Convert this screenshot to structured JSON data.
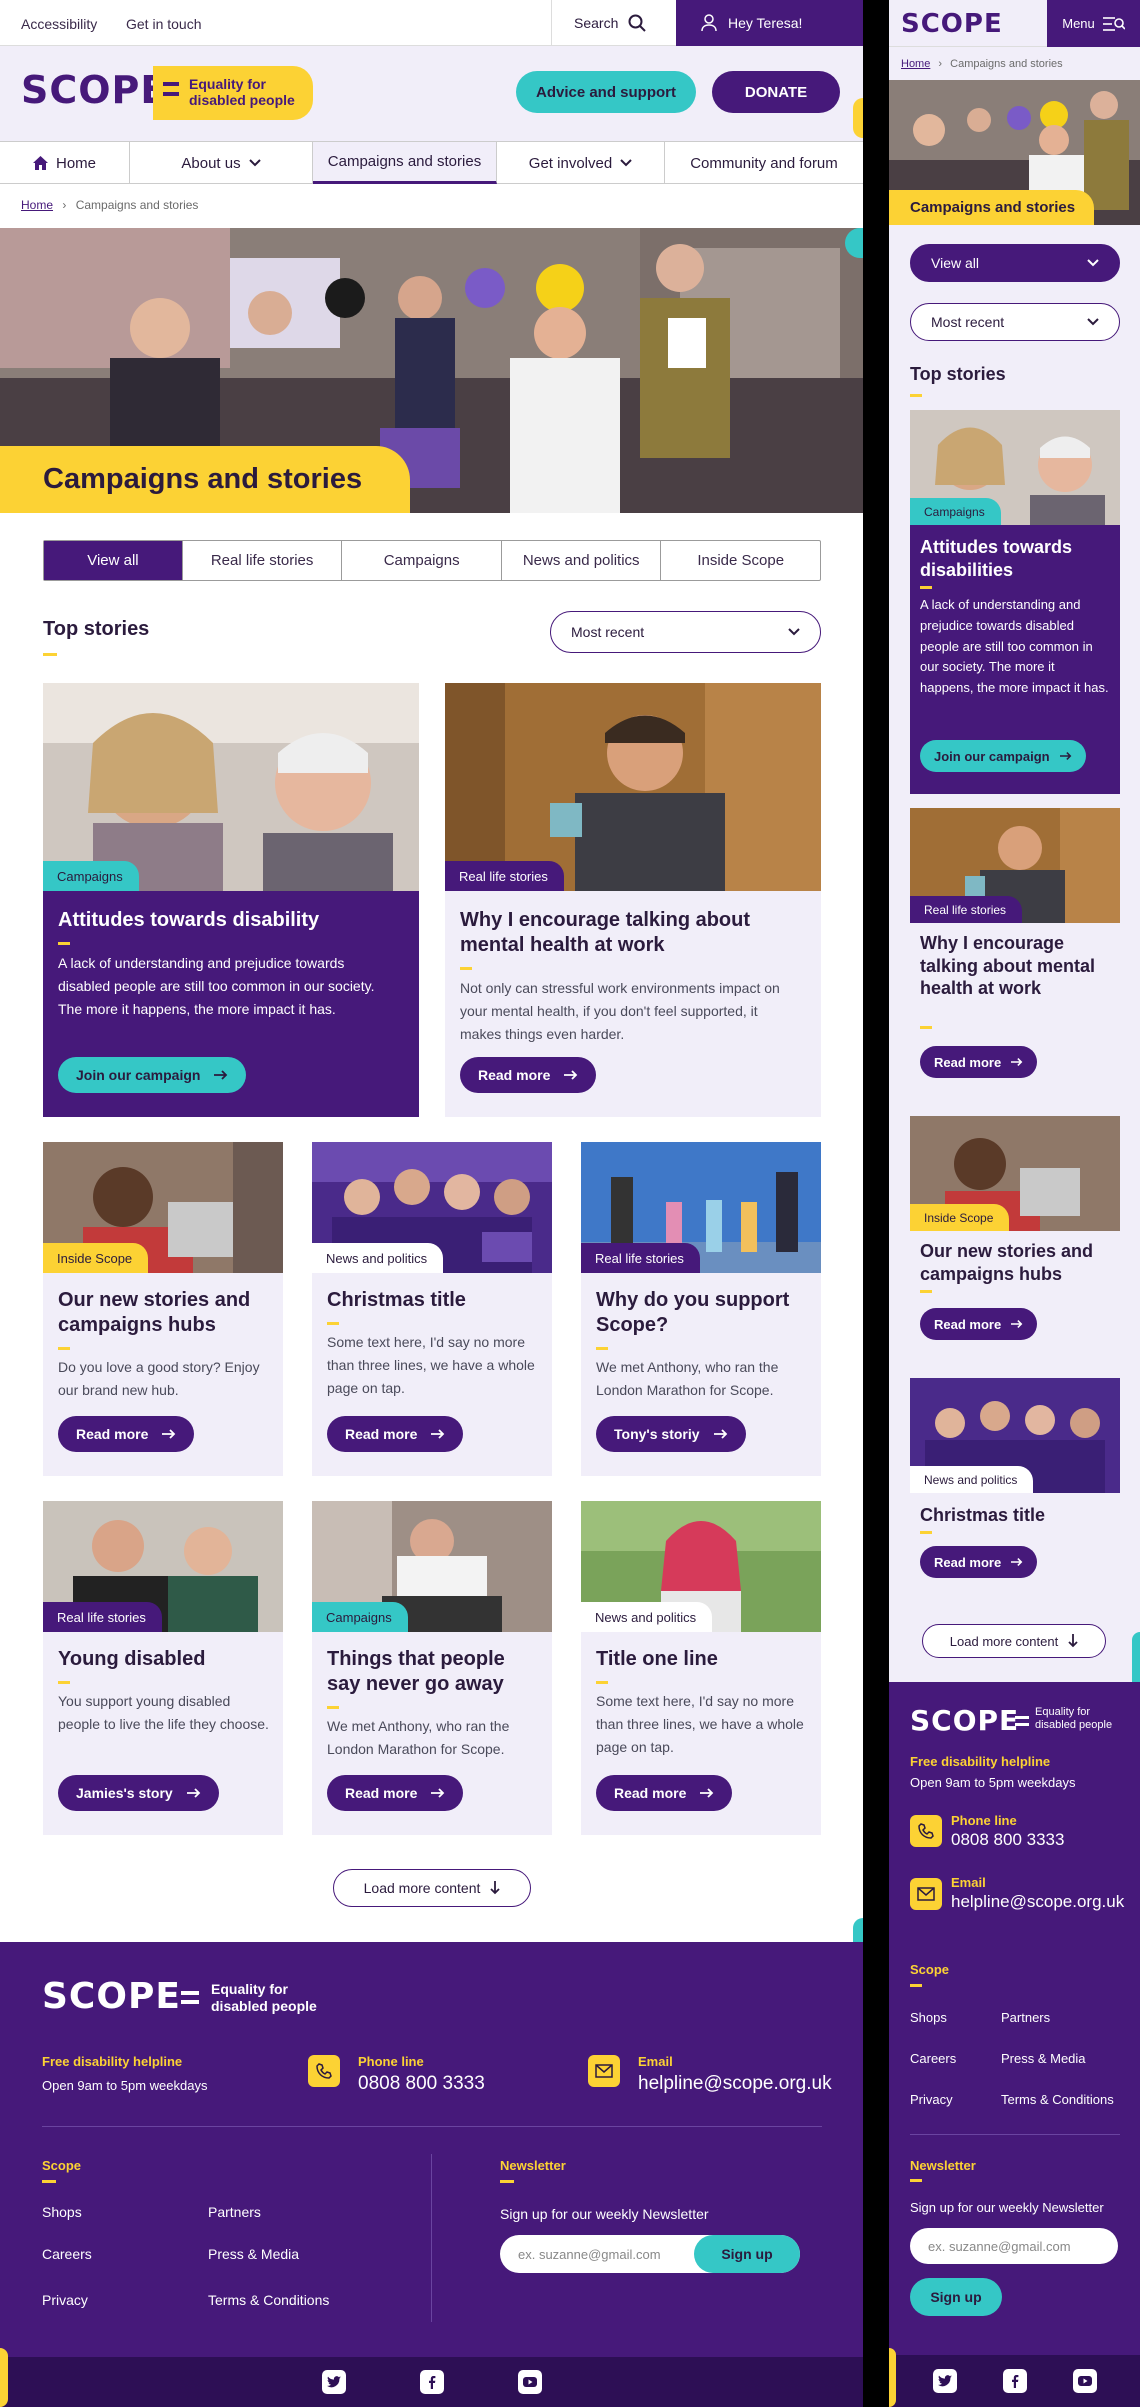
{
  "desktop": {
    "topbar": {
      "accessibility": "Accessibility",
      "get_in_touch": "Get in touch",
      "search": "Search",
      "user": "Hey Teresa!"
    },
    "logo": {
      "word": "SCOPE",
      "tagline1": "Equality for",
      "tagline2": "disabled people"
    },
    "header": {
      "advice": "Advice and support",
      "donate": "DONATE"
    },
    "nav": {
      "home": "Home",
      "about": "About us",
      "campaigns": "Campaigns and stories",
      "involved": "Get involved",
      "community": "Community and forum"
    },
    "breadcrumb": {
      "home": "Home",
      "sep": "›",
      "current": "Campaigns and stories"
    },
    "hero": {
      "title": "Campaigns and stories"
    },
    "filters": [
      "View all",
      "Real life stories",
      "Campaigns",
      "News and politics",
      "Inside Scope"
    ],
    "top_stories": {
      "title": "Top stories",
      "sort": "Most recent"
    },
    "feature_cards": [
      {
        "tag": "Campaigns",
        "title": "Attitudes towards disability",
        "desc": "A lack of understanding and prejudice towards disabled people are still too common in our society. The more it happens, the more impact it has.",
        "button": "Join our campaign"
      },
      {
        "tag": "Real life stories",
        "title": "Why I encourage talking about mental health at work",
        "desc": "Not only can stressful work environments impact on your mental health, if you don't feel supported, it makes things even harder.",
        "button": "Read more"
      }
    ],
    "cards": [
      {
        "tag": "Inside Scope",
        "title": "Our new stories and campaigns hubs",
        "desc": "Do you love a good story? Enjoy our brand new hub.",
        "button": "Read more"
      },
      {
        "tag": "News and politics",
        "title": "Christmas title",
        "desc": "Some text here, I'd say no more than three lines, we have a whole page on tap.",
        "button": "Read more"
      },
      {
        "tag": "Real life stories",
        "title": "Why do you support Scope?",
        "desc": "We met Anthony, who ran the London Marathon for Scope.",
        "button": "Tony's storiy"
      },
      {
        "tag": "Real life stories",
        "title": "Young disabled",
        "desc": "You support young disabled people to live the life they choose.",
        "button": "Jamies's story"
      },
      {
        "tag": "Campaigns",
        "title": "Things that people say never go away",
        "desc": "We met Anthony, who ran the London Marathon for Scope.",
        "button": "Read more"
      },
      {
        "tag": "News and politics",
        "title": "Title one line",
        "desc": "Some text here, I'd say no more than three lines, we have a whole page on tap.",
        "button": "Read more"
      }
    ],
    "load_more": "Load more content",
    "footer": {
      "helpline_label": "Free disability helpline",
      "helpline_hours": "Open 9am to 5pm weekdays",
      "phone_label": "Phone line",
      "phone": "0808 800 3333",
      "email_label": "Email",
      "email": "helpline@scope.org.uk",
      "scope_label": "Scope",
      "links": [
        "Shops",
        "Partners",
        "Careers",
        "Press & Media",
        "Privacy",
        "Terms & Conditions"
      ],
      "newsletter_label": "Newsletter",
      "newsletter_text": "Sign up for our weekly Newsletter",
      "newsletter_placeholder": "ex. suzanne@gmail.com",
      "signup": "Sign up"
    }
  },
  "mobile": {
    "logo": "SCOPE",
    "menu": "Menu",
    "breadcrumb": {
      "home": "Home",
      "sep": "›",
      "current": "Campaigns and stories"
    },
    "hero_title": "Campaigns and stories",
    "filter": "View all",
    "sort": "Most recent",
    "top_stories": "Top stories",
    "cards": [
      {
        "tag": "Campaigns",
        "title": "Attitudes towards disabilities",
        "desc": "A lack of understanding and prejudice towards disabled people are still too common in our society. The more it happens, the more impact it has.",
        "button": "Join our campaign"
      },
      {
        "tag": "Real life stories",
        "title": "Why I encourage talking about mental health at work",
        "button": "Read more"
      },
      {
        "tag": "Inside Scope",
        "title": "Our new stories and campaigns hubs",
        "button": "Read more"
      },
      {
        "tag": "News and politics",
        "title": "Christmas title",
        "button": "Read more"
      }
    ],
    "load_more": "Load more content",
    "footer": {
      "tagline1": "Equality for",
      "tagline2": "disabled people",
      "helpline_label": "Free disability helpline",
      "helpline_hours": "Open 9am to 5pm weekdays",
      "phone_label": "Phone line",
      "phone": "0808 800 3333",
      "email_label": "Email",
      "email": "helpline@scope.org.uk",
      "scope_label": "Scope",
      "links": [
        "Shops",
        "Partners",
        "Careers",
        "Press & Media",
        "Privacy",
        "Terms & Conditions"
      ],
      "newsletter_label": "Newsletter",
      "newsletter_text": "Sign up for our weekly Newsletter",
      "newsletter_placeholder": "ex. suzanne@gmail.com",
      "signup": "Sign up"
    }
  },
  "colors": {
    "purple": "#46197a",
    "yellow": "#fcd234",
    "teal": "#35c7c6",
    "lavender": "#f1eef9"
  }
}
